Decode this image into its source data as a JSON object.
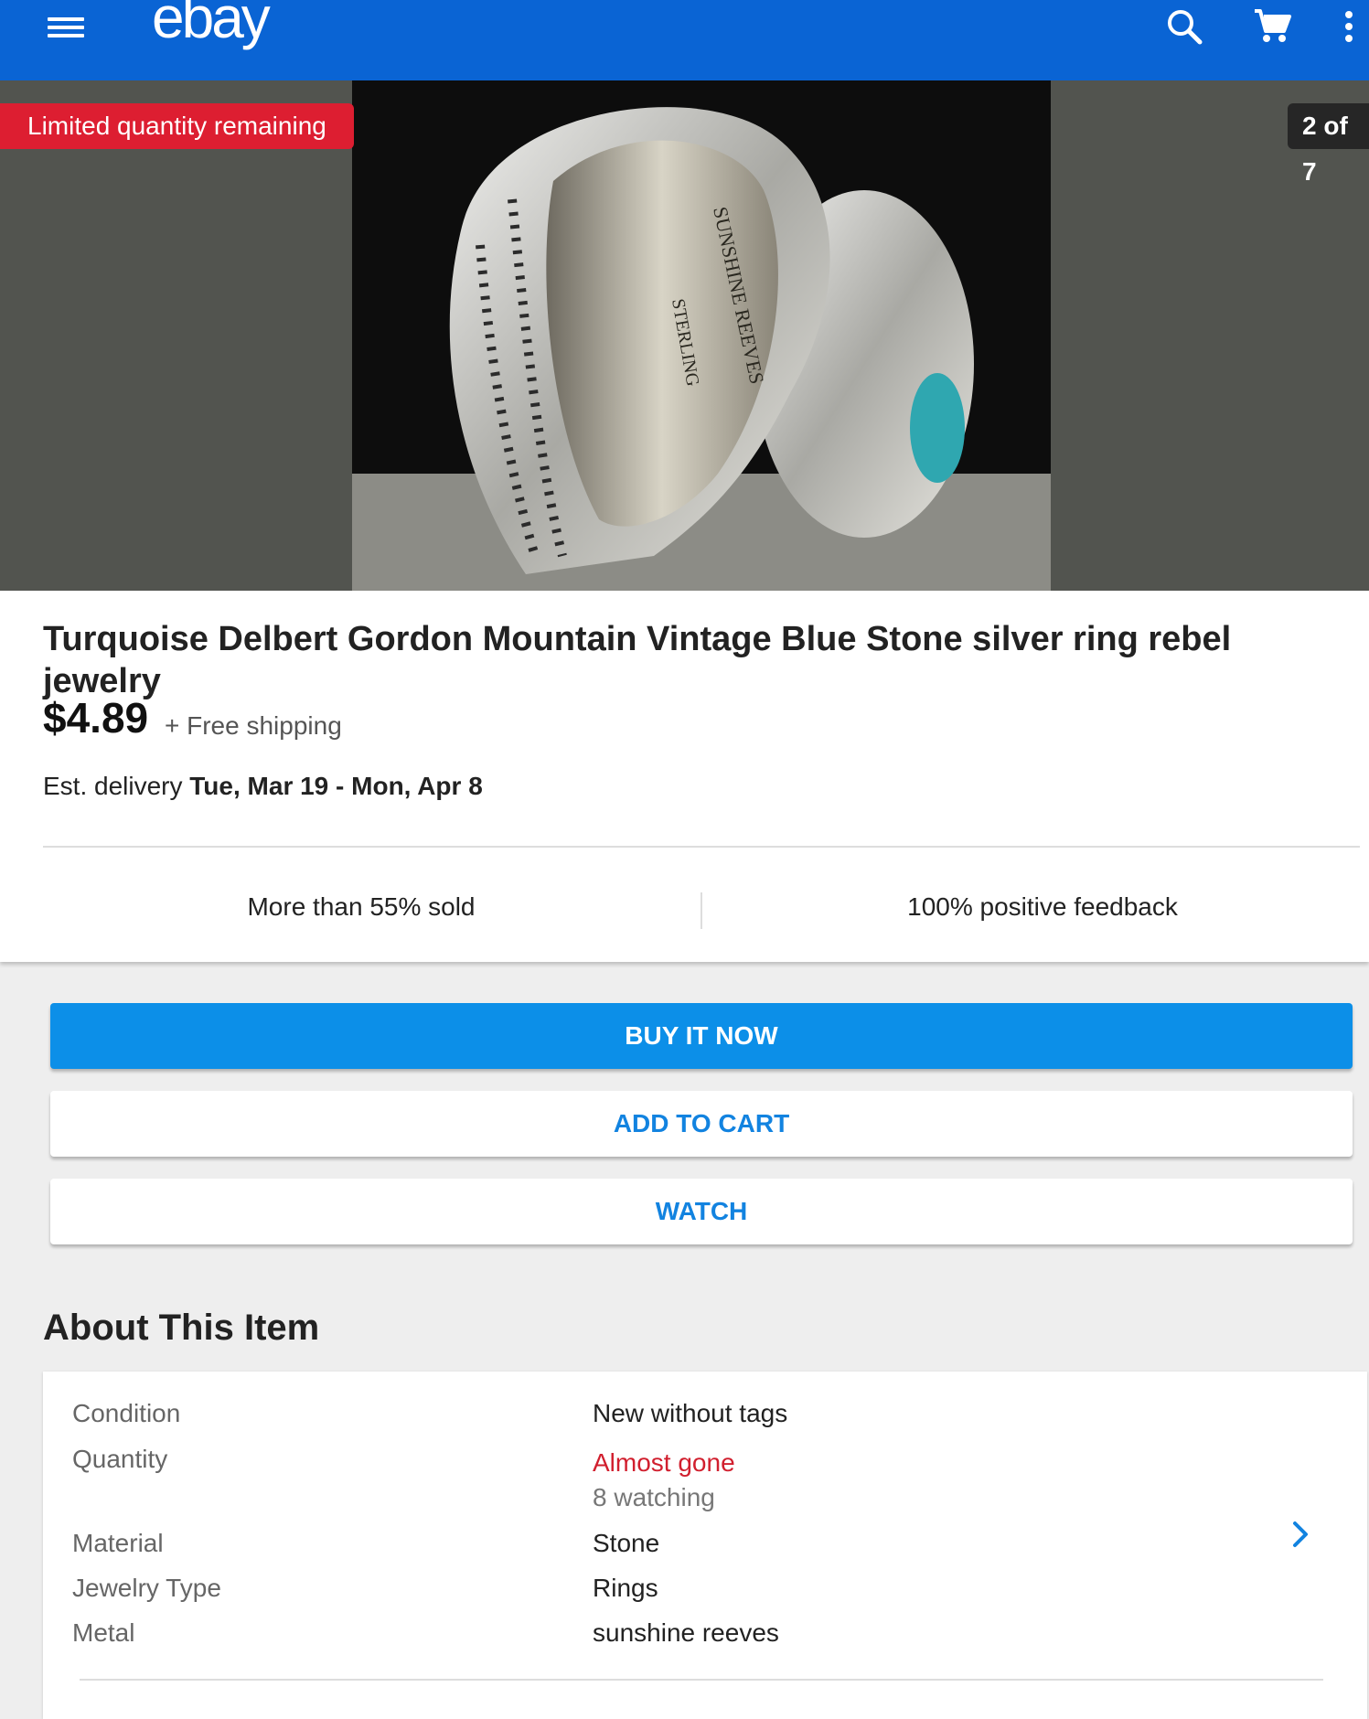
{
  "header": {
    "logo": "ebay"
  },
  "gallery": {
    "badge_limited": "Limited quantity remaining",
    "image_counter": "2 of 7",
    "ring_engraving_line1": "SUNSHINE REEVES",
    "ring_engraving_line2": "STERLING"
  },
  "item": {
    "title": "Turquoise Delbert Gordon Mountain Vintage Blue Stone silver ring rebel jewelry",
    "price": "$4.89",
    "shipping": "+ Free shipping",
    "delivery_prefix": "Est. delivery",
    "delivery_range": "Tue, Mar 19 - Mon, Apr 8",
    "stat_sold": "More than 55% sold",
    "stat_feedback": "100% positive feedback"
  },
  "actions": {
    "buy_now": "BUY IT NOW",
    "add_to_cart": "ADD TO CART",
    "watch": "WATCH"
  },
  "about": {
    "heading": "About This Item",
    "rows": [
      {
        "label": "Condition",
        "value": "New without tags"
      },
      {
        "label": "Quantity",
        "value": "Almost gone",
        "sub": "8 watching"
      },
      {
        "label": "Material",
        "value": "Stone"
      },
      {
        "label": "Jewelry Type",
        "value": "Rings"
      },
      {
        "label": "Metal",
        "value": "sunshine reeves"
      }
    ]
  },
  "colors": {
    "brand_blue": "#0a64d4",
    "button_blue": "#0c8fe8",
    "link_blue": "#1283e0",
    "alert_red": "#dd1e31"
  }
}
